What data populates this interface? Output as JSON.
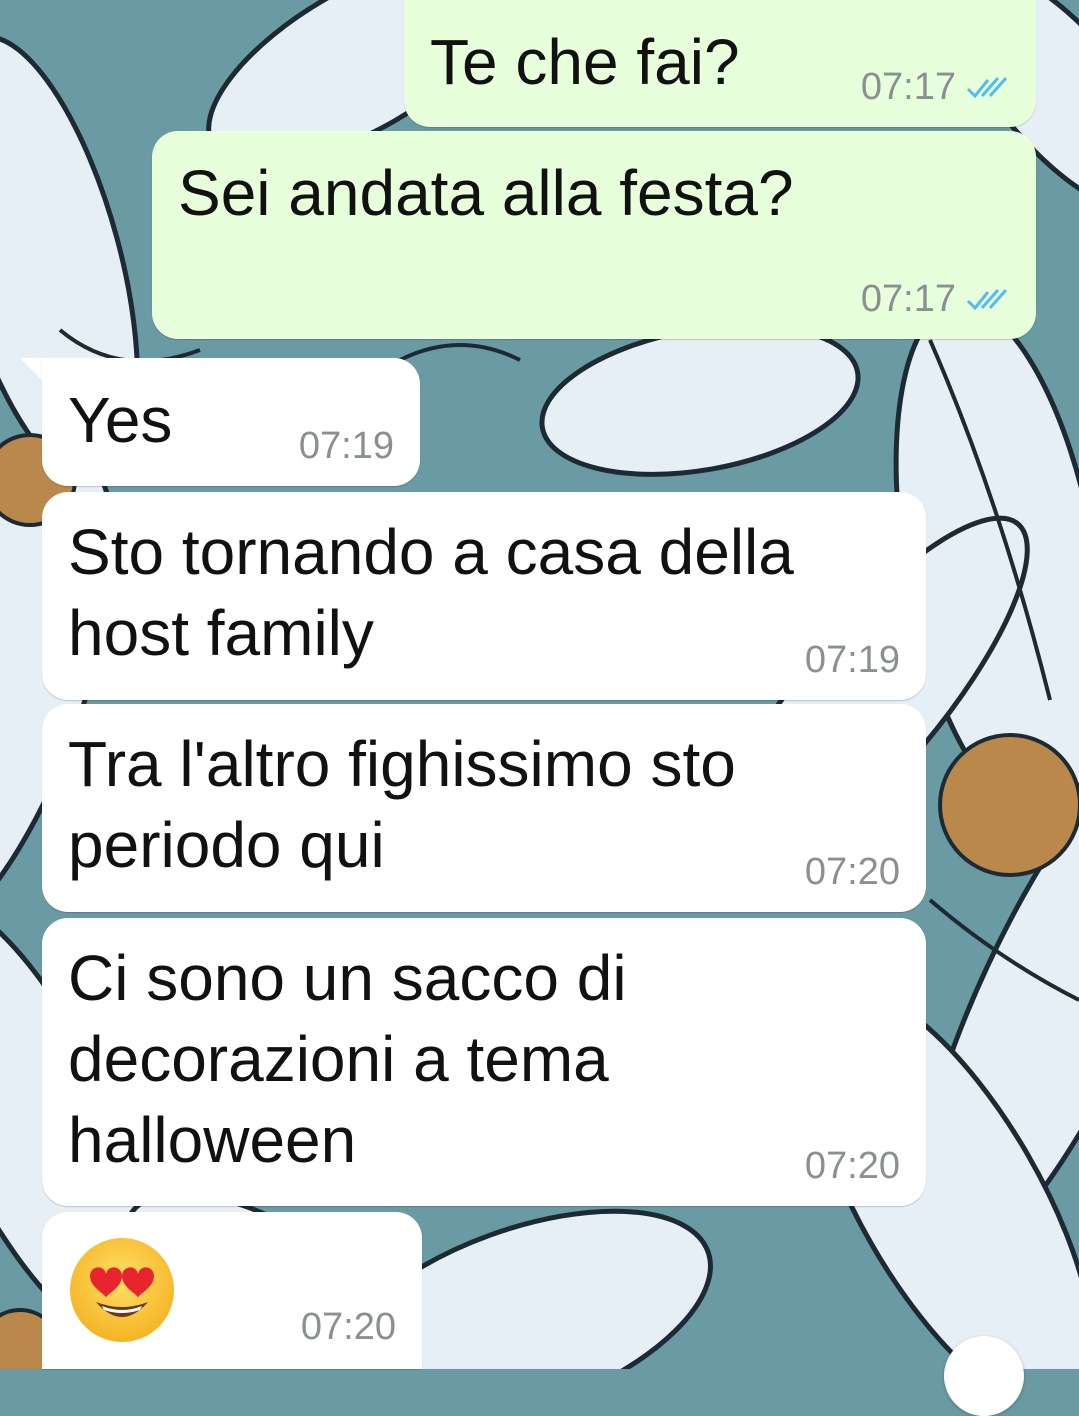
{
  "colors": {
    "outgoing_bubble": "#e7ffdb",
    "incoming_bubble": "#ffffff",
    "read_ticks": "#53bdeb",
    "timestamp": "#8a8f92",
    "wallpaper": "#6a9aa3"
  },
  "messages": [
    {
      "direction": "out",
      "text": "Te che fai?",
      "time": "07:17",
      "status": "read"
    },
    {
      "direction": "out",
      "text": "Sei andata alla festa?",
      "time": "07:17",
      "status": "read"
    },
    {
      "direction": "in",
      "text": "Yes",
      "time": "07:19"
    },
    {
      "direction": "in",
      "text": "Sto tornando a casa della\nhost family",
      "time": "07:19"
    },
    {
      "direction": "in",
      "text": "Tra l'altro fighissimo sto\nperiodo qui",
      "time": "07:20"
    },
    {
      "direction": "in",
      "text": "Ci sono un sacco di\ndecorazioni a tema\nhalloween",
      "time": "07:20"
    },
    {
      "direction": "in",
      "text": "",
      "emoji": "heart-eyes-emoji",
      "time": "07:20"
    }
  ]
}
